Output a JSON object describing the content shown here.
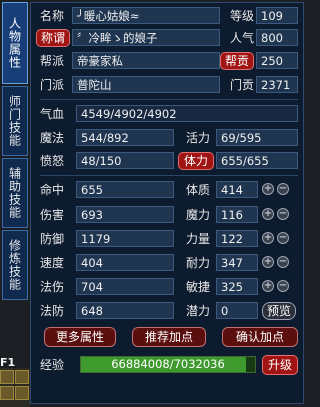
{
  "tabs": [
    "人物属性",
    "师门技能",
    "辅助技能",
    "修炼技能"
  ],
  "basic": {
    "name_label": "名称",
    "name_value": "╯暖心姑娘≈",
    "level_label": "等级",
    "level_value": "109",
    "title_button": "称谓",
    "title_value": "〞冷眸ゝ的娘子",
    "popularity_label": "人气",
    "popularity_value": "800",
    "gang_label": "帮派",
    "gang_value": "帝豪家私",
    "gang_contrib_button": "帮贡",
    "gang_contrib_value": "250",
    "sect_label": "门派",
    "sect_value": "普陀山",
    "sect_contrib_label": "门贡",
    "sect_contrib_value": "2371"
  },
  "vitals": {
    "hp_label": "气血",
    "hp_value": "4549/4902/4902",
    "mp_label": "魔法",
    "mp_value": "544/892",
    "vitality_label": "活力",
    "vitality_value": "69/595",
    "rage_label": "愤怒",
    "rage_value": "48/150",
    "stamina_button": "体力",
    "stamina_value": "655/655"
  },
  "stats_left": [
    {
      "label": "命中",
      "value": "655"
    },
    {
      "label": "伤害",
      "value": "693"
    },
    {
      "label": "防御",
      "value": "1179"
    },
    {
      "label": "速度",
      "value": "404"
    },
    {
      "label": "法伤",
      "value": "704"
    },
    {
      "label": "法防",
      "value": "648"
    }
  ],
  "stats_right": [
    {
      "label": "体质",
      "value": "414"
    },
    {
      "label": "魔力",
      "value": "116"
    },
    {
      "label": "力量",
      "value": "122"
    },
    {
      "label": "耐力",
      "value": "347"
    },
    {
      "label": "敏捷",
      "value": "325"
    },
    {
      "label": "潜力",
      "value": "0"
    }
  ],
  "plus_symbol": "+",
  "minus_symbol": "−",
  "preview_button": "预览",
  "buttons": {
    "more_attributes": "更多属性",
    "recommend_points": "推荐加点",
    "confirm_points": "确认加点"
  },
  "experience": {
    "label": "经验",
    "value": "66884008/7032036",
    "progress": 0.95,
    "upgrade_button": "升级"
  },
  "hotkey": "F1",
  "colors": {
    "panel_bg": "#0d1b2e",
    "red_button": "#a01414",
    "exp_fill": "#3f9a2e"
  }
}
